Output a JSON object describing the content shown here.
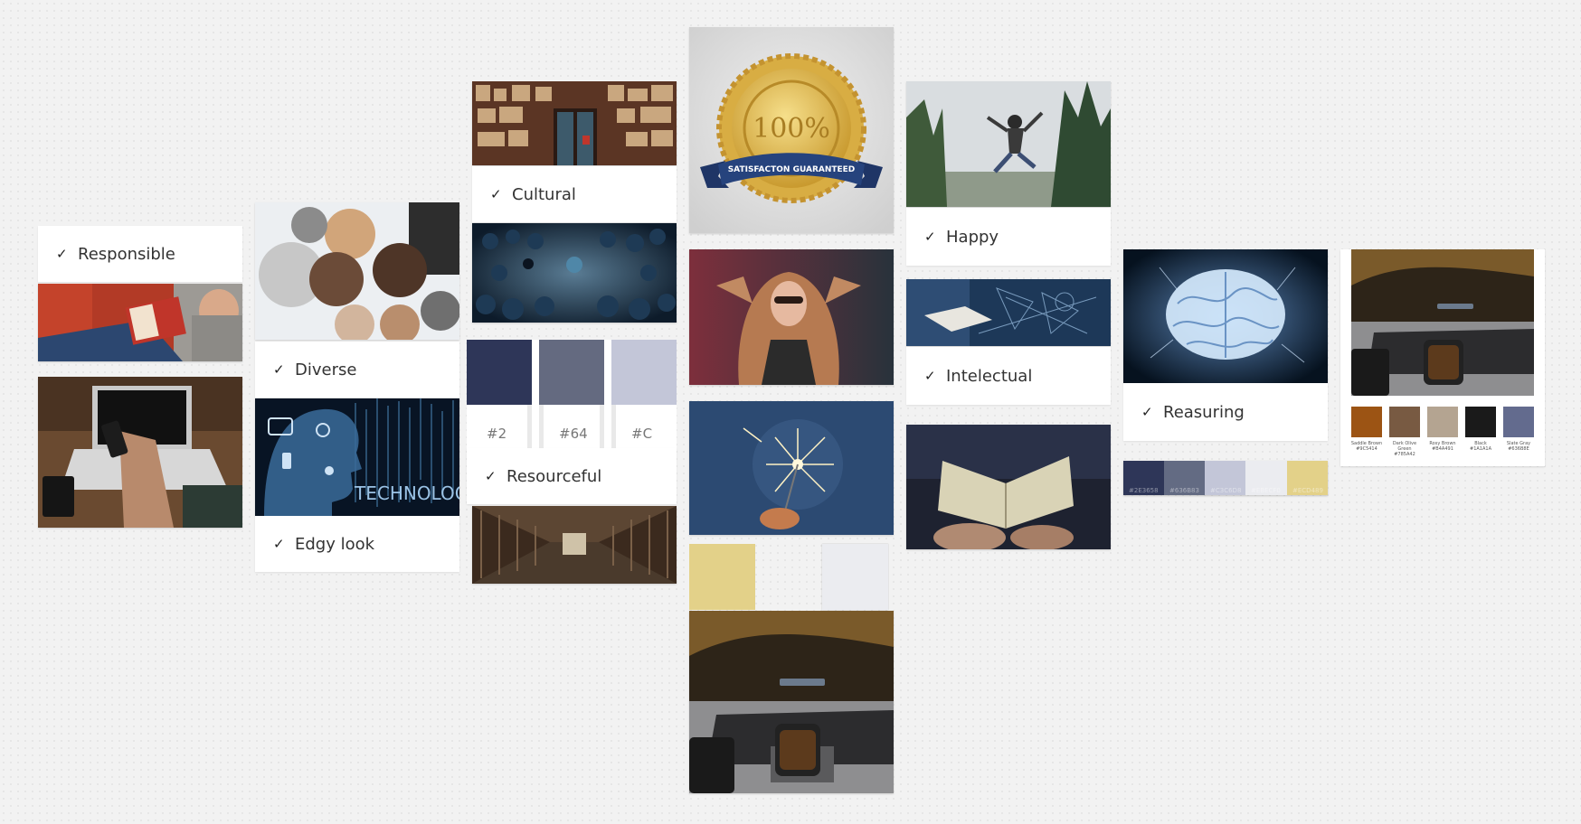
{
  "board": {
    "labels": {
      "responsible": "Responsible",
      "diverse": "Diverse",
      "edgy": "Edgy look",
      "cultural": "Cultural",
      "resourceful": "Resourceful",
      "happy": "Happy",
      "intelectual": "Intelectual",
      "reasuring": "Reasuring"
    },
    "check_glyph": "✓",
    "swatches": [
      {
        "hex_label": "#2",
        "color": "#2e3658"
      },
      {
        "hex_label": "#64",
        "color": "#646a80"
      },
      {
        "hex_label": "#C",
        "color": "#c3c6d8"
      }
    ],
    "badge": {
      "percent": "100%",
      "ribbon": "SATISFACTON GUARANTEED"
    },
    "technology_text": "TECHNOLOGY",
    "palette_strip": [
      {
        "hex": "#2E3658",
        "color": "#2e3658"
      },
      {
        "hex": "#636B83",
        "color": "#636b83"
      },
      {
        "hex": "#C3C6D8",
        "color": "#c3c6d8"
      },
      {
        "hex": "#EBECF0",
        "color": "#ebecf0"
      },
      {
        "hex": "#ECD489",
        "color": "#e3d189"
      }
    ],
    "earth_palette": [
      {
        "name": "Saddle Brown",
        "hex": "#9C5414",
        "color": "#9c5414"
      },
      {
        "name": "Dark Olive Green",
        "hex": "#785A42",
        "color": "#785a42"
      },
      {
        "name": "Rosy Brown",
        "hex": "#B4A491",
        "color": "#b4a491"
      },
      {
        "name": "Black",
        "hex": "#1A1A1A",
        "color": "#1a1a1a"
      },
      {
        "name": "Slate Gray",
        "hex": "#636B8E",
        "color": "#636b8e"
      }
    ],
    "loose_swatches": [
      {
        "color": "#e3d189"
      },
      {
        "color": "#ebecf0"
      }
    ],
    "accent": "#2e3658"
  }
}
